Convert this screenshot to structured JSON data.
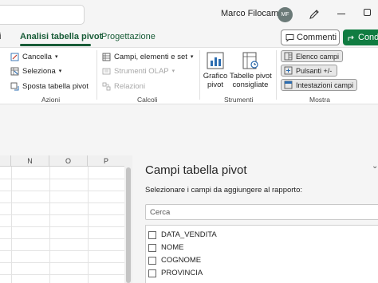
{
  "titlebar": {
    "user_name": "Marco Filocamo",
    "avatar_initials": "MF"
  },
  "tabs": {
    "partial": "ti",
    "pivot_analyze": "Analisi tabella pivot",
    "design": "Progettazione"
  },
  "header_buttons": {
    "comments": "Commenti",
    "share": "Cond"
  },
  "ribbon": {
    "actions": {
      "clear": "Cancella",
      "select": "Seleziona",
      "move_pivot": "Sposta tabella pivot",
      "label": "Azioni"
    },
    "calculations": {
      "fields_items_sets": "Campi, elementi e set",
      "olap_tools": "Strumenti OLAP",
      "relations": "Relazioni",
      "label": "Calcoli"
    },
    "tools": {
      "pivot_chart_line1": "Grafico",
      "pivot_chart_line2": "pivot",
      "recommended_line1": "Tabelle pivot",
      "recommended_line2": "consigliate",
      "label": "Strumenti"
    },
    "show": {
      "field_list": "Elenco campi",
      "buttons": "Pulsanti +/-",
      "field_headers": "Intestazioni campi",
      "label": "Mostra"
    }
  },
  "grid": {
    "columns": [
      "N",
      "O",
      "P"
    ]
  },
  "pivot_pane": {
    "title": "Campi tabella pivot",
    "subtitle": "Selezionare i campi da aggiungere al rapporto:",
    "search_placeholder": "Cerca",
    "fields": [
      "DATA_VENDITA",
      "NOME",
      "COGNOME",
      "PROVINCIA"
    ]
  },
  "colors": {
    "accent_green": "#185c37",
    "share_green": "#107c41",
    "avatar_bg": "#6b7a78"
  }
}
